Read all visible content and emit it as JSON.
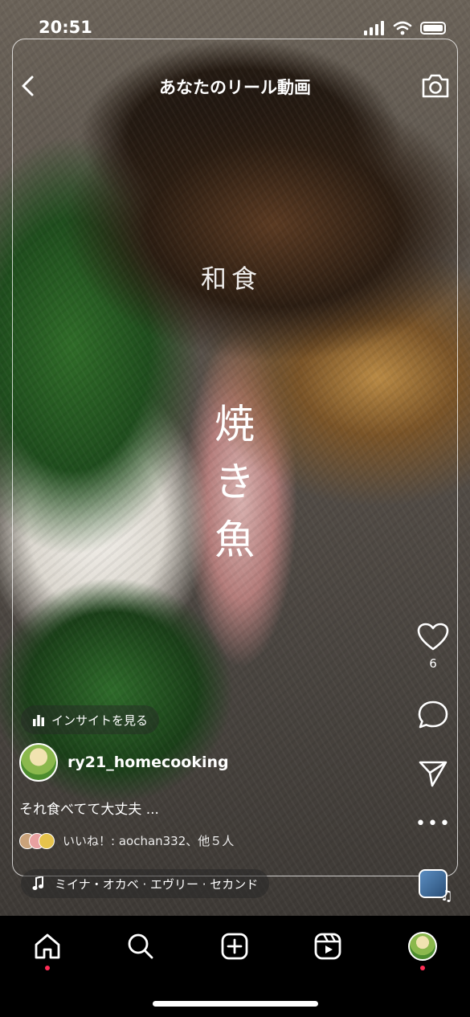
{
  "status": {
    "time": "20:51"
  },
  "header": {
    "title": "あなたのリール動画"
  },
  "overlay": {
    "category": "和食",
    "dish_chars": [
      "焼",
      "き",
      "魚"
    ]
  },
  "actions": {
    "like_count": "6"
  },
  "post": {
    "insights_label": "インサイトを見る",
    "username": "ry21_homecooking",
    "caption": "それ食べてて大丈夫 ...",
    "likes_text": "いいね！: aochan332、他５人",
    "music_text": "ミイナ・オカベ · エヴリー · セカンド"
  },
  "colors": {
    "notification_dot": "#ff2d55"
  }
}
